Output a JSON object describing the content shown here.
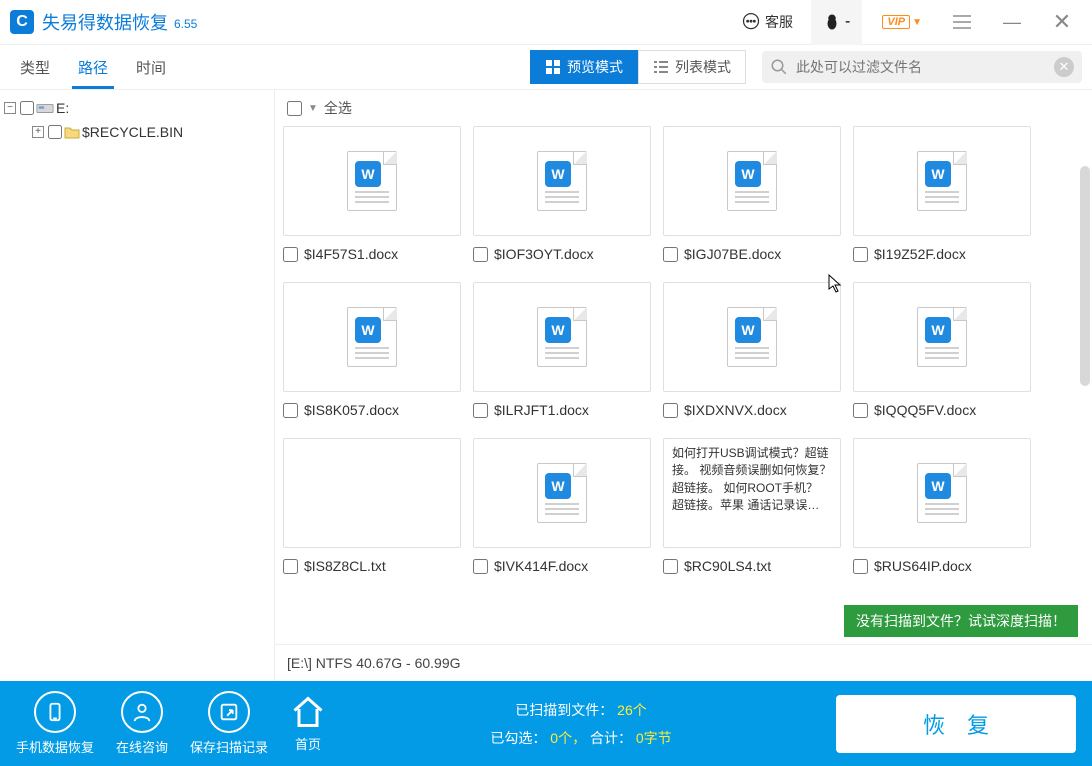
{
  "app": {
    "title": "失易得数据恢复",
    "version": "6.55"
  },
  "titlebar": {
    "kefu": "客服",
    "penguin_label": "-"
  },
  "tabs": {
    "type": "类型",
    "path": "路径",
    "time": "时间"
  },
  "view": {
    "preview": "预览模式",
    "list": "列表模式"
  },
  "search": {
    "placeholder": "此处可以过滤文件名"
  },
  "tree": {
    "drive": "E:",
    "recycle": "$RECYCLE.BIN"
  },
  "select_all": "全选",
  "files": [
    {
      "name": "$I4F57S1.docx",
      "type": "doc"
    },
    {
      "name": "$IOF3OYT.docx",
      "type": "doc"
    },
    {
      "name": "$IGJ07BE.docx",
      "type": "doc"
    },
    {
      "name": "$I19Z52F.docx",
      "type": "doc"
    },
    {
      "name": "$IS8K057.docx",
      "type": "doc"
    },
    {
      "name": "$ILRJFT1.docx",
      "type": "doc"
    },
    {
      "name": "$IXDXNVX.docx",
      "type": "doc"
    },
    {
      "name": "$IQQQ5FV.docx",
      "type": "doc"
    },
    {
      "name": "$IS8Z8CL.txt",
      "type": "blank"
    },
    {
      "name": "$IVK414F.docx",
      "type": "doc"
    },
    {
      "name": "$RC90LS4.txt",
      "type": "text",
      "preview": "如何打开USB调试模式？超链接。\n视频音频误删如何恢复？超链接。\n如何ROOT手机？　超链接。苹果 通话记录误…"
    },
    {
      "name": "$RUS64IP.docx",
      "type": "doc"
    }
  ],
  "status": {
    "line": "[E:\\] NTFS 40.67G - 60.99G"
  },
  "deep_scan": "没有扫描到文件？试试深度扫描！",
  "footer": {
    "phone": "手机数据恢复",
    "consult": "在线咨询",
    "save": "保存扫描记录",
    "home": "首页",
    "scanned_label": "已扫描到文件：",
    "scanned_count": "26个",
    "checked_label": "已勾选：",
    "checked_count": "0个，",
    "total_label": "合计：",
    "total_size": "0字节",
    "recover": "恢复"
  },
  "vip": "VIP"
}
